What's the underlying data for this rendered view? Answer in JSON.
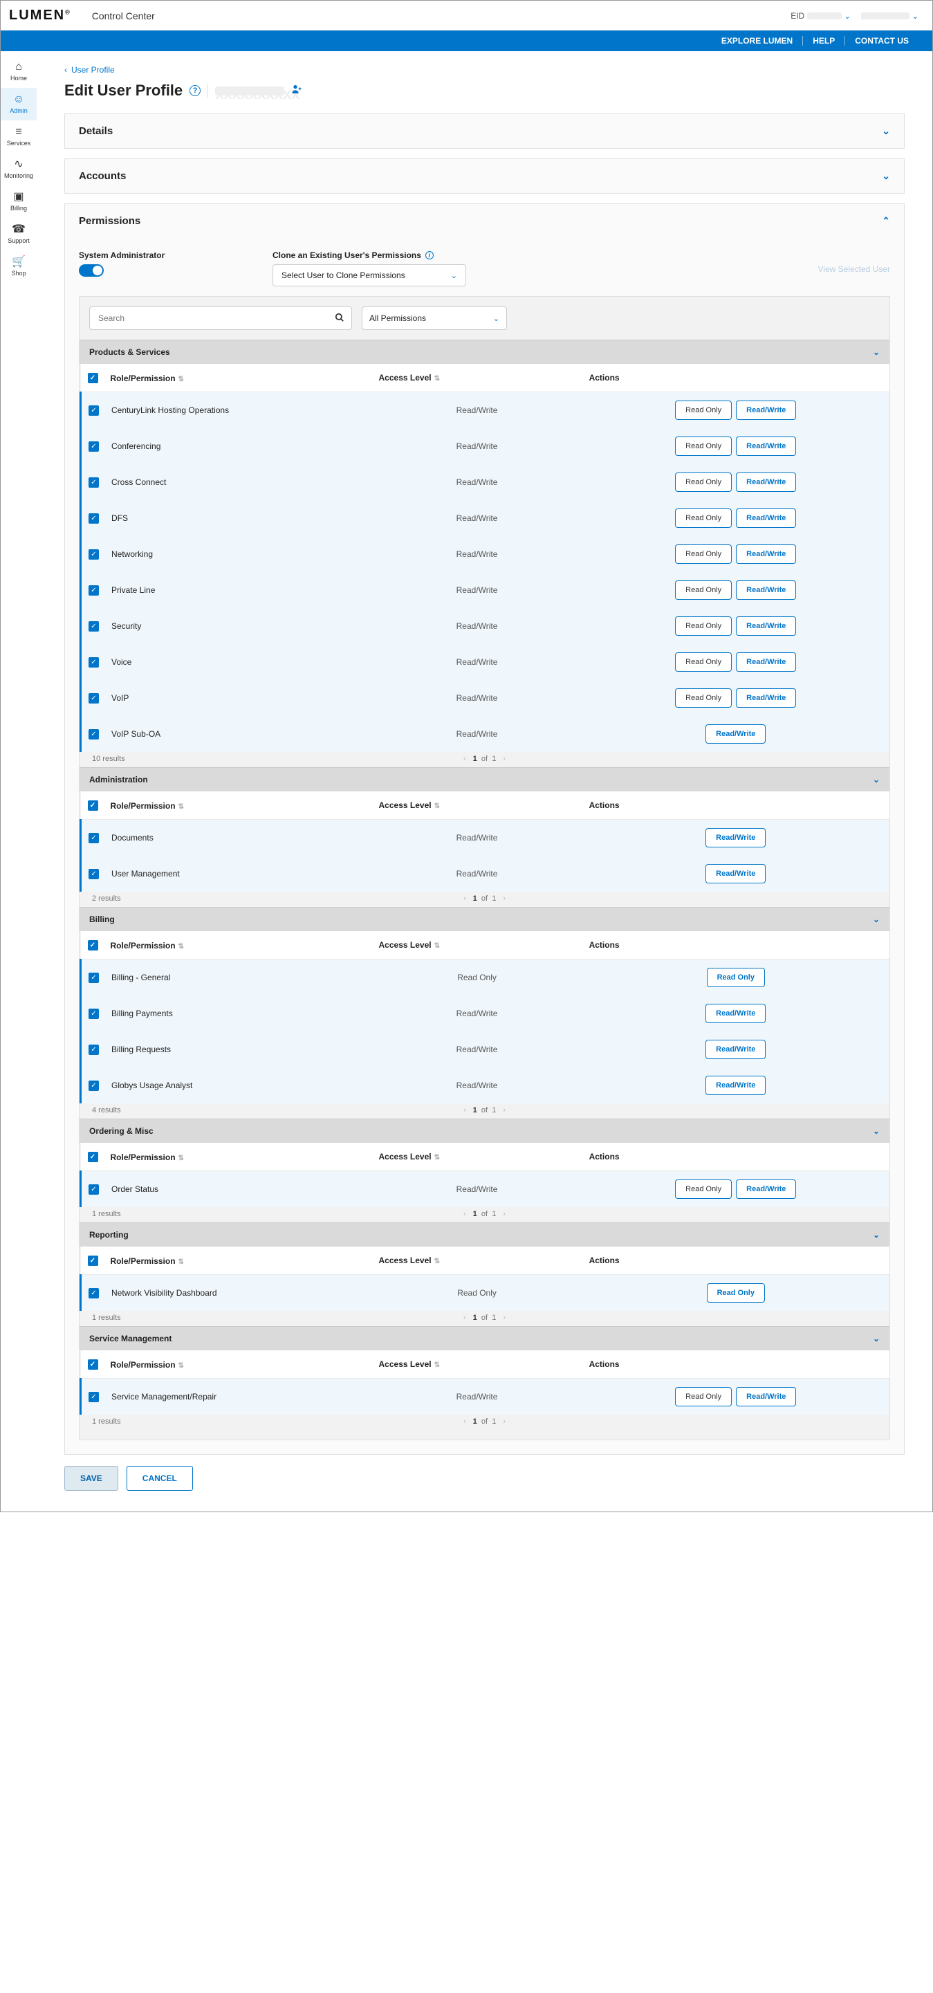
{
  "brand": "LUMEN",
  "app": "Control Center",
  "eid_label": "EID",
  "bluebar": {
    "explore": "EXPLORE LUMEN",
    "help": "HELP",
    "contact": "CONTACT US"
  },
  "nav": [
    {
      "icon": "⌂",
      "label": "Home"
    },
    {
      "icon": "☺",
      "label": "Admin"
    },
    {
      "icon": "≡",
      "label": "Services"
    },
    {
      "icon": "∿",
      "label": "Monitoring"
    },
    {
      "icon": "▣",
      "label": "Billing"
    },
    {
      "icon": "☎",
      "label": "Support"
    },
    {
      "icon": "🛒",
      "label": "Shop"
    }
  ],
  "crumb": "User Profile",
  "title": "Edit User Profile",
  "panels": {
    "details": "Details",
    "accounts": "Accounts",
    "permissions": "Permissions"
  },
  "perm": {
    "sysadmin": "System Administrator",
    "clone_lbl": "Clone an Existing User's Permissions",
    "clone_select": "Select User to Clone Permissions",
    "view_selected": "View Selected User",
    "search_ph": "Search",
    "all_perm": "All Permissions"
  },
  "cols": {
    "role": "Role/Permission",
    "access": "Access Level",
    "actions": "Actions"
  },
  "btn": {
    "ro": "Read Only",
    "rw": "Read/Write"
  },
  "page": {
    "of": "of",
    "one": "1"
  },
  "foot": {
    "save": "SAVE",
    "cancel": "CANCEL"
  },
  "sections": [
    {
      "title": "Products & Services",
      "rows": [
        {
          "role": "CenturyLink Hosting Operations",
          "access": "Read/Write",
          "actions": [
            "ro",
            "rw"
          ],
          "sel": "rw"
        },
        {
          "role": "Conferencing",
          "access": "Read/Write",
          "actions": [
            "ro",
            "rw"
          ],
          "sel": "rw"
        },
        {
          "role": "Cross Connect",
          "access": "Read/Write",
          "actions": [
            "ro",
            "rw"
          ],
          "sel": "rw"
        },
        {
          "role": "DFS",
          "access": "Read/Write",
          "actions": [
            "ro",
            "rw"
          ],
          "sel": "rw"
        },
        {
          "role": "Networking",
          "access": "Read/Write",
          "actions": [
            "ro",
            "rw"
          ],
          "sel": "rw"
        },
        {
          "role": "Private Line",
          "access": "Read/Write",
          "actions": [
            "ro",
            "rw"
          ],
          "sel": "rw"
        },
        {
          "role": "Security",
          "access": "Read/Write",
          "actions": [
            "ro",
            "rw"
          ],
          "sel": "rw"
        },
        {
          "role": "Voice",
          "access": "Read/Write",
          "actions": [
            "ro",
            "rw"
          ],
          "sel": "rw"
        },
        {
          "role": "VoIP",
          "access": "Read/Write",
          "actions": [
            "ro",
            "rw"
          ],
          "sel": "rw"
        },
        {
          "role": "VoIP Sub-OA",
          "access": "Read/Write",
          "actions": [
            "rw"
          ],
          "sel": "rw"
        }
      ],
      "results": "10 results"
    },
    {
      "title": "Administration",
      "rows": [
        {
          "role": "Documents",
          "access": "Read/Write",
          "actions": [
            "rw"
          ],
          "sel": "rw"
        },
        {
          "role": "User Management",
          "access": "Read/Write",
          "actions": [
            "rw"
          ],
          "sel": "rw"
        }
      ],
      "results": "2 results"
    },
    {
      "title": "Billing",
      "rows": [
        {
          "role": "Billing - General",
          "access": "Read Only",
          "actions": [
            "ro"
          ],
          "sel": "ro"
        },
        {
          "role": "Billing Payments",
          "access": "Read/Write",
          "actions": [
            "rw"
          ],
          "sel": "rw"
        },
        {
          "role": "Billing Requests",
          "access": "Read/Write",
          "actions": [
            "rw"
          ],
          "sel": "rw"
        },
        {
          "role": "Globys Usage Analyst",
          "access": "Read/Write",
          "actions": [
            "rw"
          ],
          "sel": "rw"
        }
      ],
      "results": "4 results"
    },
    {
      "title": "Ordering & Misc",
      "rows": [
        {
          "role": "Order Status",
          "access": "Read/Write",
          "actions": [
            "ro",
            "rw"
          ],
          "sel": "rw"
        }
      ],
      "results": "1 results"
    },
    {
      "title": "Reporting",
      "rows": [
        {
          "role": "Network Visibility Dashboard",
          "access": "Read Only",
          "actions": [
            "ro"
          ],
          "sel": "ro"
        }
      ],
      "results": "1 results"
    },
    {
      "title": "Service Management",
      "rows": [
        {
          "role": "Service Management/Repair",
          "access": "Read/Write",
          "actions": [
            "ro",
            "rw"
          ],
          "sel": "rw"
        }
      ],
      "results": "1 results"
    }
  ]
}
